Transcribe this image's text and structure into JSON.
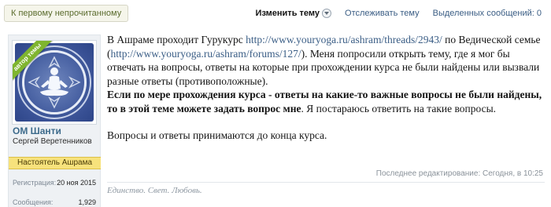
{
  "topbar": {
    "unread_label": "К первому непрочитанному",
    "edit_topic_label": "Изменить тему",
    "watch_topic_label": "Отслеживать тему",
    "selected_messages_label": "Выделенных сообщений: 0"
  },
  "author": {
    "ribbon": "автор темы",
    "username": "ОМ Шанти",
    "realname": "Сергей Веретенников",
    "role": "Настоятель Ашрама",
    "stats": [
      {
        "label": "Регистрация:",
        "value": "20 ноя 2015"
      },
      {
        "label": "Сообщения:",
        "value": "1,929"
      }
    ]
  },
  "post": {
    "p1_a": "В Ашраме проходит Гурукурс ",
    "link1": "http://www.youryoga.ru/ashram/threads/2943/",
    "p1_b": " по Ведической семье (",
    "link2": "http://www.youryoga.ru/ashram/forums/127/",
    "p1_c": "). Меня попросили открыть тему, где я мог бы отвечать на вопросы, ответы на которые при прохождении курса не были найдены или вызвали разные ответы (противоположные).",
    "p2_bold": "Если по мере прохождения курса - ответы на какие-то важные вопросы не были найдены, то в этой теме можете задать вопрос мне",
    "p2_rest": ". Я постараюсь ответить на такие вопросы.",
    "p3": "Вопросы и ответы принимаются до конца курса.",
    "last_edit": "Последнее редактирование: Сегодня, в 10:25",
    "signature": "Единство. Свет. Любовь."
  },
  "colors": {
    "link": "#3b5e86",
    "role_badge": "#f7e27c",
    "ribbon": "#7fb52f",
    "avatar_bg": "#4d66a6"
  },
  "icons": {
    "edit_dropdown": "chevron-down-icon",
    "avatar_art": "meditation-mandala-icon"
  }
}
